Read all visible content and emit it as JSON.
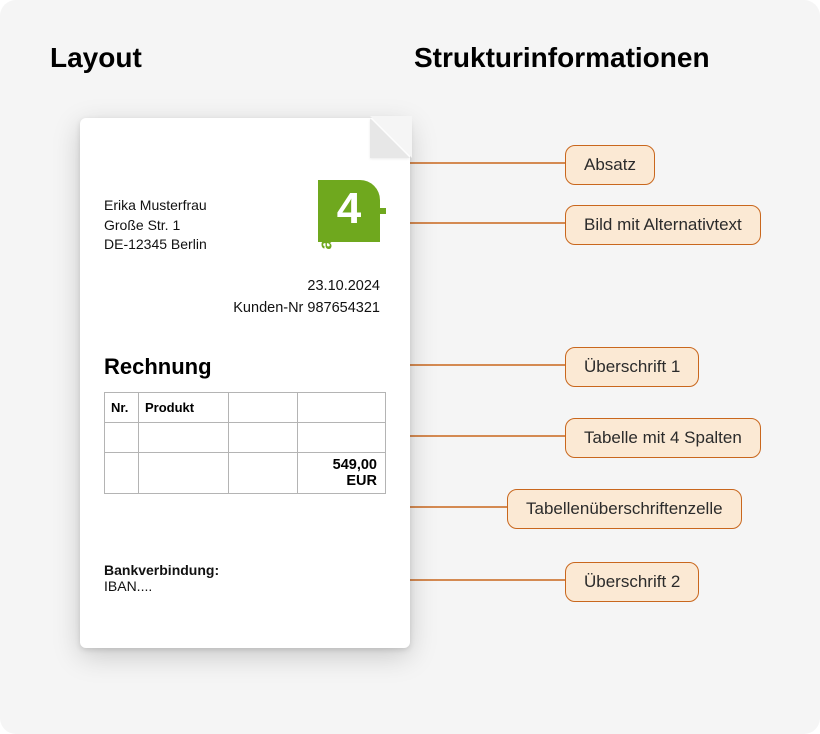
{
  "headings": {
    "left": "Layout",
    "right": "Strukturinformationen"
  },
  "document": {
    "address": {
      "name": "Erika Musterfrau",
      "street": "Große Str. 1",
      "city": "DE-12345 Berlin"
    },
    "logo": {
      "word": "axes",
      "digit": "4"
    },
    "meta": {
      "date": "23.10.2024",
      "customer": "Kunden-Nr 987654321"
    },
    "invoice_title": "Rechnung",
    "table": {
      "headers": {
        "nr": "Nr.",
        "product": "Produkt"
      },
      "total": "549,00 EUR"
    },
    "bank": {
      "label": "Bankverbindung:",
      "iban": "IBAN...."
    }
  },
  "callouts": {
    "absatz": "Absatz",
    "bild": "Bild mit Alternativtext",
    "h1": "Überschrift 1",
    "tabelle": "Tabelle mit 4 Spalten",
    "th": "Tabellenüberschriftenzelle",
    "h2": "Überschrift 2"
  }
}
